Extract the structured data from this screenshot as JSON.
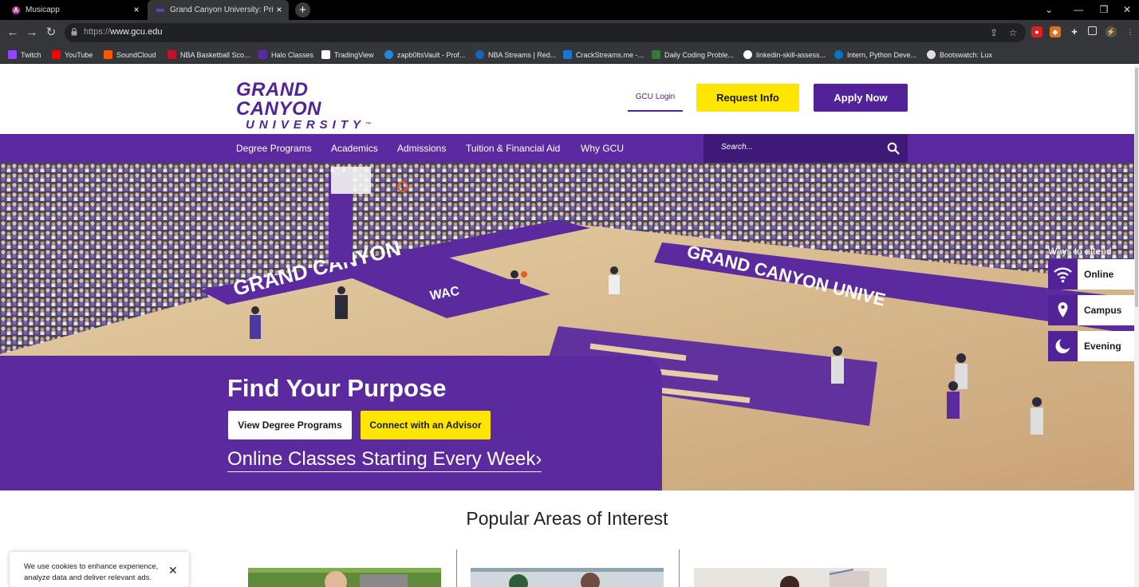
{
  "browser": {
    "tabs": [
      {
        "title": "Musicapp"
      },
      {
        "title": "Grand Canyon University: Private Christian University"
      }
    ],
    "new_tab": "+",
    "url_scheme": "https://",
    "url_host": "www.gcu.edu",
    "bookmarks": [
      {
        "label": "Twitch",
        "color": "#9146ff"
      },
      {
        "label": "YouTube",
        "color": "#ff0000"
      },
      {
        "label": "SoundCloud",
        "color": "#ff5500"
      },
      {
        "label": "NBA Basketball Sco...",
        "color": "#c8102e"
      },
      {
        "label": "Halo Classes",
        "color": "#5c2aa0"
      },
      {
        "label": "TradingView",
        "color": "#131722"
      },
      {
        "label": "zapb0ltsVault - Prof...",
        "color": "#1e88e5"
      },
      {
        "label": "NBA Streams | Red...",
        "color": "#1565c0"
      },
      {
        "label": "CrackStreams.me -...",
        "color": "#1976d2"
      },
      {
        "label": "Daily Coding Proble...",
        "color": "#2e7d32"
      },
      {
        "label": "linkedin-skill-assess...",
        "color": "#ffffff"
      },
      {
        "label": "Intern, Python Deve...",
        "color": "#0277bd"
      },
      {
        "label": "Bootswatch: Lux",
        "color": "#e0e0e0"
      }
    ]
  },
  "header": {
    "logo_line1": "GRAND CANYON",
    "logo_line2": "UNIVERSITY",
    "logo_tm": "™",
    "login": "GCU Login",
    "request_info": "Request Info",
    "apply_now": "Apply Now"
  },
  "nav": {
    "items": [
      "Degree Programs",
      "Academics",
      "Admissions",
      "Tuition & Financial Aid",
      "Why GCU"
    ],
    "search_placeholder": "Search..."
  },
  "hero": {
    "title": "Find Your Purpose",
    "btn_view": "View Degree Programs",
    "btn_connect": "Connect with an Advisor",
    "link": "Online Classes Starting Every Week",
    "link_arrow": "›",
    "ways_label": "Ways to attend",
    "ways": [
      {
        "label": "Online",
        "icon": "wifi-icon"
      },
      {
        "label": "Campus",
        "icon": "map-pin-icon"
      },
      {
        "label": "Evening",
        "icon": "moon-icon"
      }
    ],
    "court_text": "GRAND CANYON",
    "court_text2": "GRAND CANYON UNIVE",
    "wac": "WAC"
  },
  "section": {
    "title": "Popular Areas of Interest"
  },
  "cookie": {
    "text": "We use cookies to enhance experience, analyze data and deliver relevant ads.",
    "close": "✕"
  },
  "colors": {
    "brand_purple": "#522398",
    "nav_purple": "#5c2aa0",
    "yellow": "#ffe600"
  }
}
